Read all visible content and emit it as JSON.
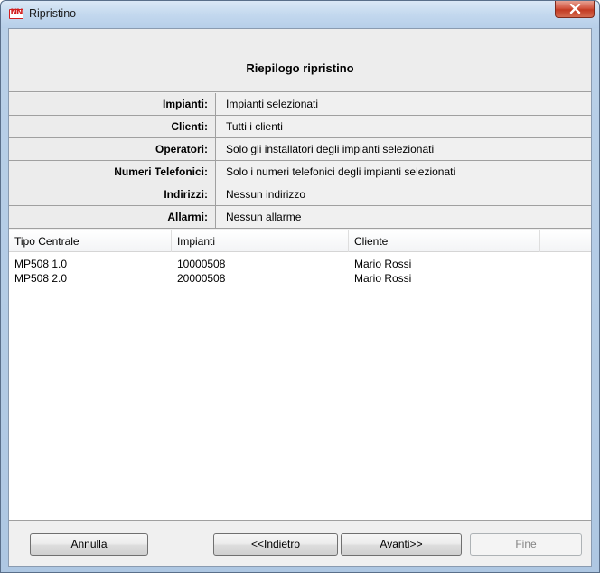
{
  "window": {
    "title": "Ripristino",
    "app_icon_text": "NN",
    "colors": {
      "title_bar": "#c3d8ee",
      "close_button": "#c23a22"
    }
  },
  "summary": {
    "heading": "Riepilogo ripristino",
    "rows": [
      {
        "label": "Impianti:",
        "value": "Impianti selezionati"
      },
      {
        "label": "Clienti:",
        "value": "Tutti i clienti"
      },
      {
        "label": "Operatori:",
        "value": "Solo gli installatori degli impianti selezionati"
      },
      {
        "label": "Numeri Telefonici:",
        "value": "Solo i numeri telefonici degli impianti selezionati"
      },
      {
        "label": "Indirizzi:",
        "value": "Nessun indirizzo"
      },
      {
        "label": "Allarmi:",
        "value": "Nessun allarme"
      }
    ]
  },
  "table": {
    "columns": [
      "Tipo Centrale",
      "Impianti",
      "Cliente"
    ],
    "rows": [
      [
        "MP508 1.0",
        "10000508",
        "Mario Rossi"
      ],
      [
        "MP508 2.0",
        "20000508",
        "Mario Rossi"
      ]
    ]
  },
  "buttons": {
    "cancel": "Annulla",
    "back": "<<Indietro",
    "next": "Avanti>>",
    "finish": "Fine"
  }
}
